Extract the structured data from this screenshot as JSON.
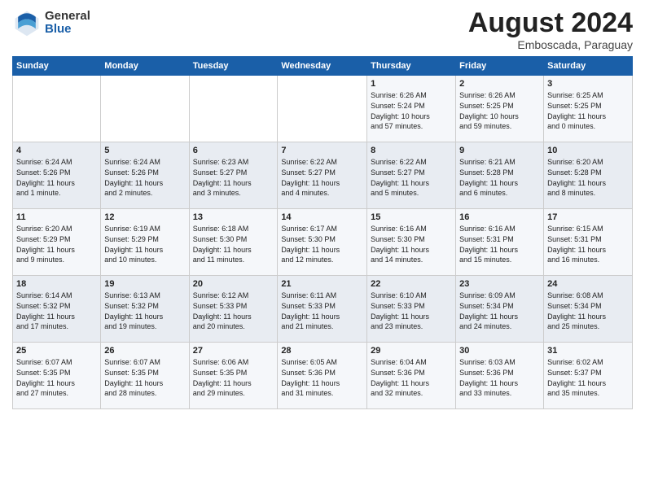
{
  "logo": {
    "general": "General",
    "blue": "Blue"
  },
  "title": {
    "month": "August 2024",
    "location": "Emboscada, Paraguay"
  },
  "weekdays": [
    "Sunday",
    "Monday",
    "Tuesday",
    "Wednesday",
    "Thursday",
    "Friday",
    "Saturday"
  ],
  "weeks": [
    [
      {
        "day": "",
        "info": ""
      },
      {
        "day": "",
        "info": ""
      },
      {
        "day": "",
        "info": ""
      },
      {
        "day": "",
        "info": ""
      },
      {
        "day": "1",
        "info": "Sunrise: 6:26 AM\nSunset: 5:24 PM\nDaylight: 10 hours\nand 57 minutes."
      },
      {
        "day": "2",
        "info": "Sunrise: 6:26 AM\nSunset: 5:25 PM\nDaylight: 10 hours\nand 59 minutes."
      },
      {
        "day": "3",
        "info": "Sunrise: 6:25 AM\nSunset: 5:25 PM\nDaylight: 11 hours\nand 0 minutes."
      }
    ],
    [
      {
        "day": "4",
        "info": "Sunrise: 6:24 AM\nSunset: 5:26 PM\nDaylight: 11 hours\nand 1 minute."
      },
      {
        "day": "5",
        "info": "Sunrise: 6:24 AM\nSunset: 5:26 PM\nDaylight: 11 hours\nand 2 minutes."
      },
      {
        "day": "6",
        "info": "Sunrise: 6:23 AM\nSunset: 5:27 PM\nDaylight: 11 hours\nand 3 minutes."
      },
      {
        "day": "7",
        "info": "Sunrise: 6:22 AM\nSunset: 5:27 PM\nDaylight: 11 hours\nand 4 minutes."
      },
      {
        "day": "8",
        "info": "Sunrise: 6:22 AM\nSunset: 5:27 PM\nDaylight: 11 hours\nand 5 minutes."
      },
      {
        "day": "9",
        "info": "Sunrise: 6:21 AM\nSunset: 5:28 PM\nDaylight: 11 hours\nand 6 minutes."
      },
      {
        "day": "10",
        "info": "Sunrise: 6:20 AM\nSunset: 5:28 PM\nDaylight: 11 hours\nand 8 minutes."
      }
    ],
    [
      {
        "day": "11",
        "info": "Sunrise: 6:20 AM\nSunset: 5:29 PM\nDaylight: 11 hours\nand 9 minutes."
      },
      {
        "day": "12",
        "info": "Sunrise: 6:19 AM\nSunset: 5:29 PM\nDaylight: 11 hours\nand 10 minutes."
      },
      {
        "day": "13",
        "info": "Sunrise: 6:18 AM\nSunset: 5:30 PM\nDaylight: 11 hours\nand 11 minutes."
      },
      {
        "day": "14",
        "info": "Sunrise: 6:17 AM\nSunset: 5:30 PM\nDaylight: 11 hours\nand 12 minutes."
      },
      {
        "day": "15",
        "info": "Sunrise: 6:16 AM\nSunset: 5:30 PM\nDaylight: 11 hours\nand 14 minutes."
      },
      {
        "day": "16",
        "info": "Sunrise: 6:16 AM\nSunset: 5:31 PM\nDaylight: 11 hours\nand 15 minutes."
      },
      {
        "day": "17",
        "info": "Sunrise: 6:15 AM\nSunset: 5:31 PM\nDaylight: 11 hours\nand 16 minutes."
      }
    ],
    [
      {
        "day": "18",
        "info": "Sunrise: 6:14 AM\nSunset: 5:32 PM\nDaylight: 11 hours\nand 17 minutes."
      },
      {
        "day": "19",
        "info": "Sunrise: 6:13 AM\nSunset: 5:32 PM\nDaylight: 11 hours\nand 19 minutes."
      },
      {
        "day": "20",
        "info": "Sunrise: 6:12 AM\nSunset: 5:33 PM\nDaylight: 11 hours\nand 20 minutes."
      },
      {
        "day": "21",
        "info": "Sunrise: 6:11 AM\nSunset: 5:33 PM\nDaylight: 11 hours\nand 21 minutes."
      },
      {
        "day": "22",
        "info": "Sunrise: 6:10 AM\nSunset: 5:33 PM\nDaylight: 11 hours\nand 23 minutes."
      },
      {
        "day": "23",
        "info": "Sunrise: 6:09 AM\nSunset: 5:34 PM\nDaylight: 11 hours\nand 24 minutes."
      },
      {
        "day": "24",
        "info": "Sunrise: 6:08 AM\nSunset: 5:34 PM\nDaylight: 11 hours\nand 25 minutes."
      }
    ],
    [
      {
        "day": "25",
        "info": "Sunrise: 6:07 AM\nSunset: 5:35 PM\nDaylight: 11 hours\nand 27 minutes."
      },
      {
        "day": "26",
        "info": "Sunrise: 6:07 AM\nSunset: 5:35 PM\nDaylight: 11 hours\nand 28 minutes."
      },
      {
        "day": "27",
        "info": "Sunrise: 6:06 AM\nSunset: 5:35 PM\nDaylight: 11 hours\nand 29 minutes."
      },
      {
        "day": "28",
        "info": "Sunrise: 6:05 AM\nSunset: 5:36 PM\nDaylight: 11 hours\nand 31 minutes."
      },
      {
        "day": "29",
        "info": "Sunrise: 6:04 AM\nSunset: 5:36 PM\nDaylight: 11 hours\nand 32 minutes."
      },
      {
        "day": "30",
        "info": "Sunrise: 6:03 AM\nSunset: 5:36 PM\nDaylight: 11 hours\nand 33 minutes."
      },
      {
        "day": "31",
        "info": "Sunrise: 6:02 AM\nSunset: 5:37 PM\nDaylight: 11 hours\nand 35 minutes."
      }
    ]
  ]
}
